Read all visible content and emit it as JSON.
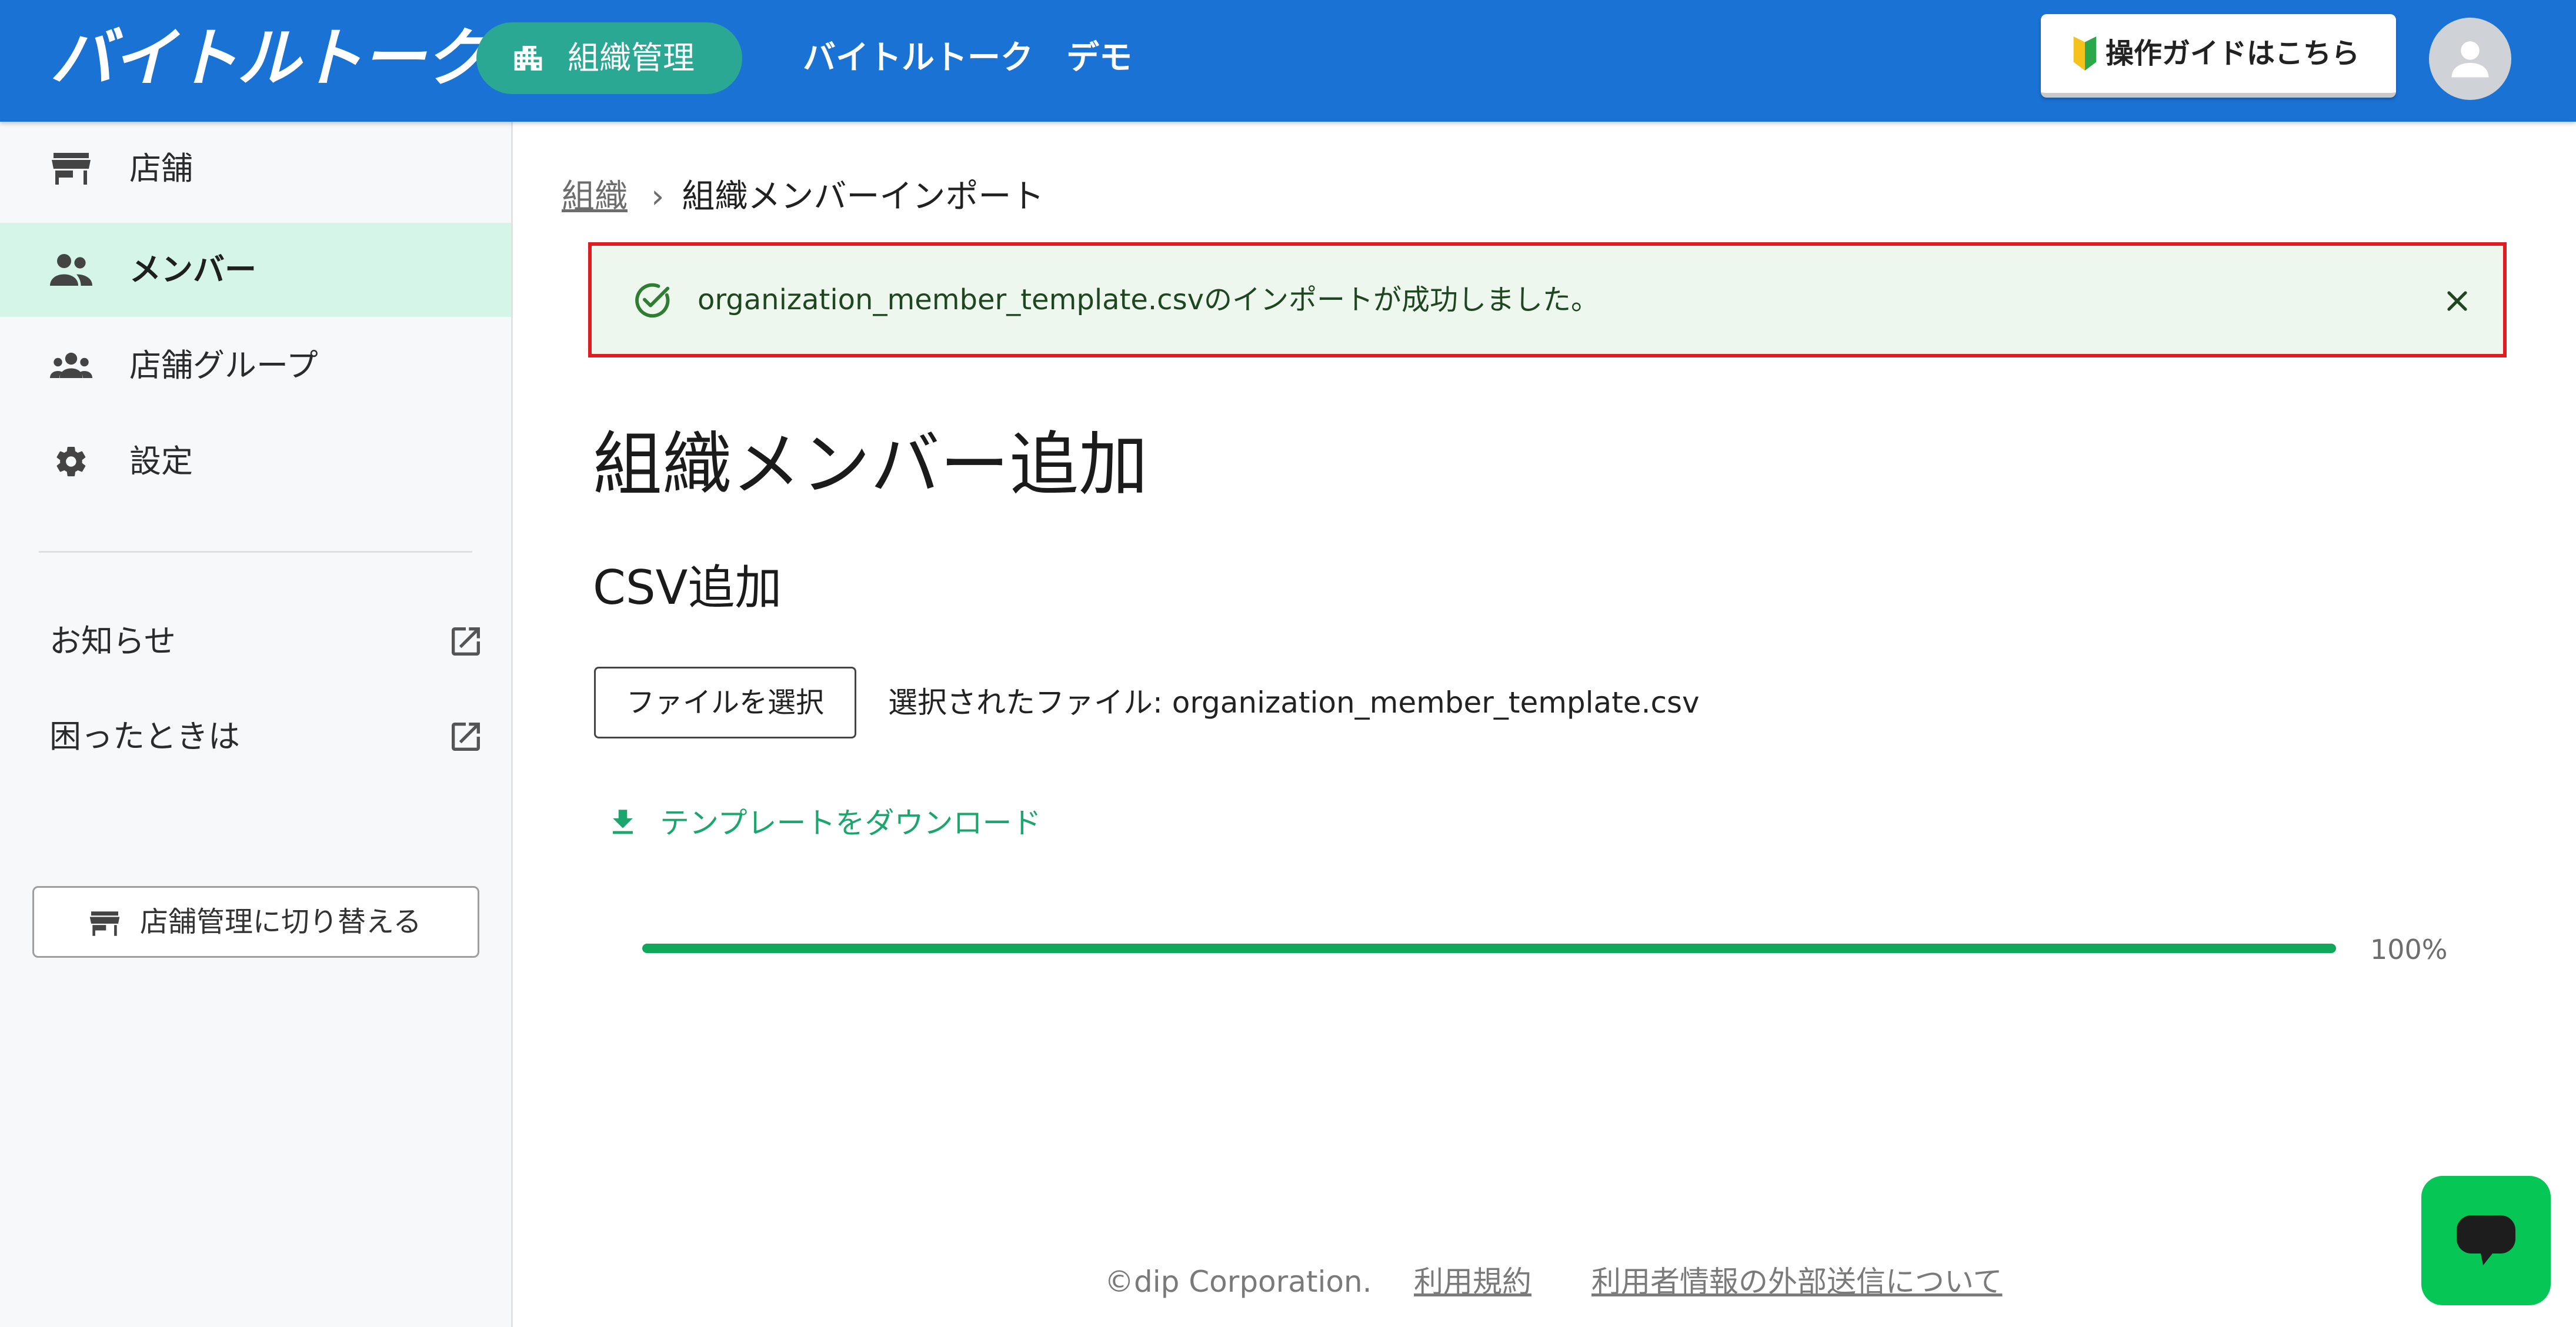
{
  "header": {
    "logo_text": "バイトルトーク",
    "org_button_label": "組織管理",
    "company_name": "バイトルトーク　デモ",
    "guide_button_label": "操作ガイドはこちら",
    "brand_color": "#1a73d4",
    "accent_color": "#2aa894"
  },
  "sidebar": {
    "items": [
      {
        "label": "店舗",
        "icon": "store-icon",
        "active": false
      },
      {
        "label": "メンバー",
        "icon": "people-icon",
        "active": true
      },
      {
        "label": "店舗グループ",
        "icon": "groups-icon",
        "active": false
      },
      {
        "label": "設定",
        "icon": "gear-icon",
        "active": false
      }
    ],
    "links": [
      {
        "label": "お知らせ",
        "icon": "external-link-icon"
      },
      {
        "label": "困ったときは",
        "icon": "external-link-icon"
      }
    ],
    "switch_button_label": "店舗管理に切り替える"
  },
  "breadcrumb": {
    "parent": "組織",
    "current": "組織メンバーインポート"
  },
  "alert": {
    "message": "organization_member_template.csvのインポートが成功しました。",
    "border_color": "#e11b22",
    "background_color": "#edf7ed"
  },
  "main": {
    "title": "組織メンバー追加",
    "section_title": "CSV追加",
    "file_button_label": "ファイルを選択",
    "selected_file_text": "選択されたファイル: organization_member_template.csv",
    "download_label": "テンプレートをダウンロード",
    "progress": {
      "value": 100,
      "label": "100%",
      "color": "#0fa85a"
    }
  },
  "footer": {
    "copyright": "©dip Corporation.",
    "terms": "利用規約",
    "external_transmission": "利用者情報の外部送信について"
  },
  "chat": {
    "icon": "chat-icon",
    "color": "#06c755"
  }
}
